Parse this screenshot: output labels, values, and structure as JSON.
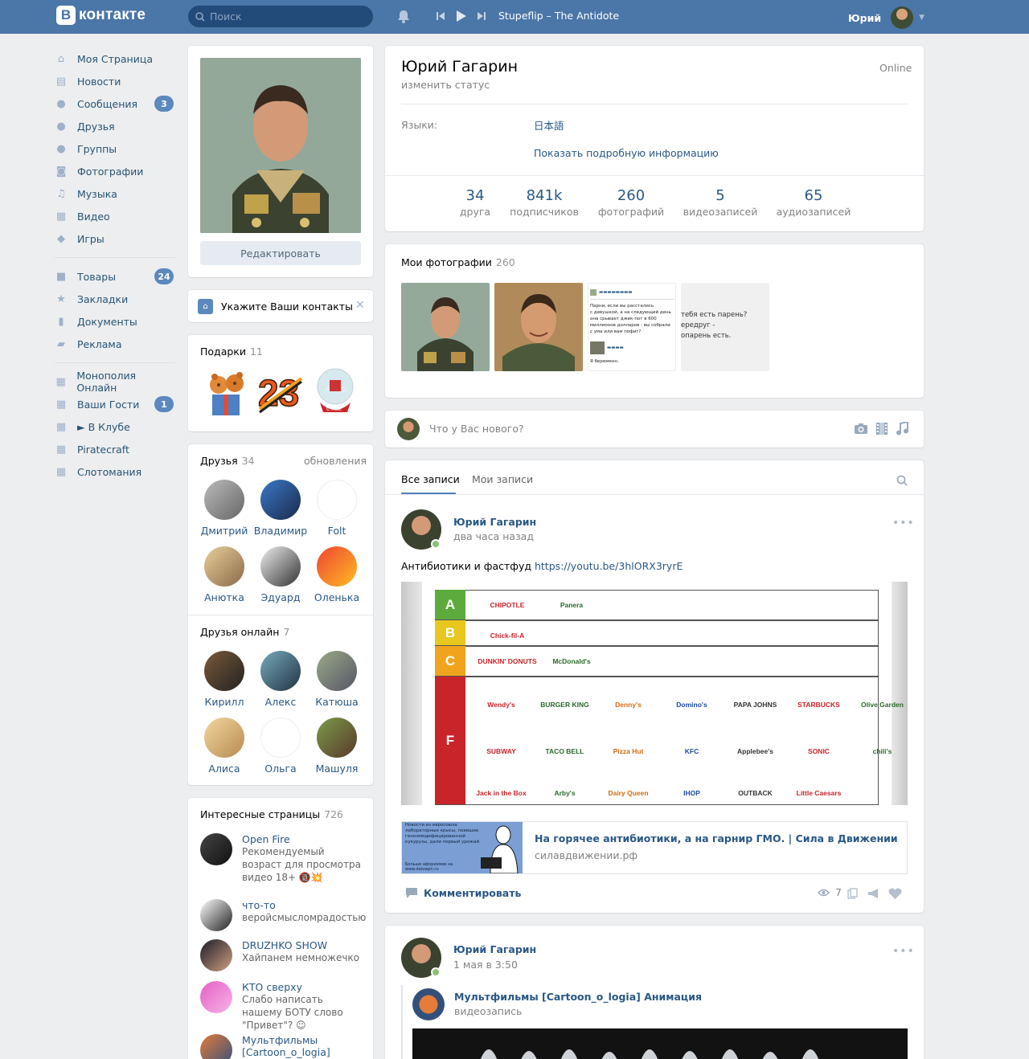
{
  "header": {
    "logo_letter": "В",
    "logo_text": "контакте",
    "search_placeholder": "Поиск",
    "track": "Stupeflip – The Antidote",
    "user_name": "Юрий"
  },
  "sidebar": {
    "items": [
      {
        "label": "Моя Страница",
        "icon": "home-icon"
      },
      {
        "label": "Новости",
        "icon": "news-icon"
      },
      {
        "label": "Сообщения",
        "icon": "messages-icon",
        "count": "3"
      },
      {
        "label": "Друзья",
        "icon": "friends-icon"
      },
      {
        "label": "Группы",
        "icon": "groups-icon"
      },
      {
        "label": "Фотографии",
        "icon": "camera-icon"
      },
      {
        "label": "Музыка",
        "icon": "music-icon"
      },
      {
        "label": "Видео",
        "icon": "video-icon"
      },
      {
        "label": "Игры",
        "icon": "games-icon"
      }
    ],
    "items2": [
      {
        "label": "Товары",
        "icon": "goods-icon",
        "count": "24"
      },
      {
        "label": "Закладки",
        "icon": "star-icon"
      },
      {
        "label": "Документы",
        "icon": "document-icon"
      },
      {
        "label": "Реклама",
        "icon": "ads-icon"
      }
    ],
    "items3": [
      {
        "label": "Монополия Онлайн",
        "icon": "app-icon"
      },
      {
        "label": "Ваши Гости",
        "icon": "app-icon",
        "count": "1"
      },
      {
        "label": "► В Клубе",
        "icon": "app-icon"
      },
      {
        "label": "Piratecraft",
        "icon": "app-icon"
      },
      {
        "label": "Слотомания",
        "icon": "app-icon"
      }
    ]
  },
  "profile": {
    "edit_label": "Редактировать",
    "contacts_label": "Укажите Ваши контакты",
    "name": "Юрий Гагарин",
    "status_link": "изменить статус",
    "online": "Online",
    "languages_label": "Языки:",
    "languages_value": "日本語",
    "more_info": "Показать подробную информацию",
    "counters": [
      {
        "n": "34",
        "l": "друга"
      },
      {
        "n": "841k",
        "l": "подписчиков"
      },
      {
        "n": "260",
        "l": "фотографий"
      },
      {
        "n": "5",
        "l": "видеозаписей"
      },
      {
        "n": "65",
        "l": "аудиозаписей"
      }
    ]
  },
  "gifts": {
    "title": "Подарки",
    "count": "11"
  },
  "friends": {
    "title": "Друзья",
    "count": "34",
    "updates": "обновления",
    "list": [
      "Дмитрий",
      "Владимир",
      "Folt",
      "Анютка",
      "Эдуард",
      "Оленька"
    ]
  },
  "friends_online": {
    "title": "Друзья онлайн",
    "count": "7",
    "list": [
      "Кирилл",
      "Алекс",
      "Катюша",
      "Алиса",
      "Ольга",
      "Машуля"
    ]
  },
  "pages": {
    "title": "Интересные страницы",
    "count": "726",
    "list": [
      {
        "name": "Open Fire",
        "desc": "Рекомендуемый возраст для просмотра видео 18+ 🔞💥"
      },
      {
        "name": "что-то",
        "desc": "веройсмысломрадостью"
      },
      {
        "name": "DRUZHKO SHOW",
        "desc": "Хайпанем немножечко"
      },
      {
        "name": "КТО сверху",
        "desc": "Слабо написать нашему БОТУ слово \"Привет\"? ☺"
      },
      {
        "name": "Мультфильмы [Cartoon_o_logia]",
        "desc": ""
      }
    ]
  },
  "photos": {
    "title": "Мои фотографии",
    "count": "260",
    "meme_lines": [
      "Парни, если вы расстались",
      "с девушкой, а на следующий день",
      "она срывает джек-пот в 600",
      "миллионов долларов - вы собрали",
      "с ума или вам пофиг?"
    ],
    "meme_footer": "Я беременн.",
    "meme2_lines": [
      "тебя есть парень?",
      "ередруг -",
      "опарень есть."
    ]
  },
  "composer": {
    "placeholder": "Что у Вас нового?"
  },
  "wall": {
    "tab_all": "Все записи",
    "tab_mine": "Мои записи",
    "post1": {
      "author": "Юрий Гагарин",
      "time": "два часа назад",
      "text": "Антибиотики и фастфуд",
      "url": "https://youtu.be/3hlORX3ryrE",
      "tiers": [
        "A",
        "B",
        "C",
        "F"
      ],
      "brands_a": [
        "CHIPOTLE",
        "Panera"
      ],
      "brands_b": [
        "Chick-fil-A"
      ],
      "brands_c": [
        "DUNKIN' DONUTS",
        "McDonald's"
      ],
      "brands_f1": [
        "Wendy's",
        "BURGER KING",
        "Denny's",
        "Domino's",
        "PAPA JOHNS",
        "STARBUCKS",
        "Olive Garden"
      ],
      "brands_f2": [
        "SUBWAY",
        "TACO BELL",
        "Pizza Hut",
        "KFC",
        "Applebee's",
        "SONIC",
        "chili's"
      ],
      "brands_f3": [
        "Jack in the Box",
        "Arby's",
        "Dairy Queen",
        "IHOP",
        "OUTBACK",
        "Little Caesars"
      ],
      "link_title": "На горячее антибиотики, а на гарнир ГМО. | Сила в Движении",
      "link_domain": "силавдвижении.рф",
      "link_img_lines": [
        "Новости из евросоюза",
        "лабораторные крысы, поевшие",
        "генномодифицированной",
        "кукурузы, дали первый урожай."
      ],
      "link_img_footer": "Больше афоризмов на www.delvaqin.ru",
      "comment": "Комментировать",
      "views": "7"
    },
    "post2": {
      "author": "Юрий Гагарин",
      "time": "1 мая в 3:50",
      "repost_name": "Мультфильмы [Cartoon_o_logia] Анимация",
      "repost_sub": "видеозапись"
    }
  },
  "colors": {
    "header": "#4a76a8",
    "link": "#2a5885",
    "bg": "#edeef0",
    "badge": "#5b88bd"
  }
}
